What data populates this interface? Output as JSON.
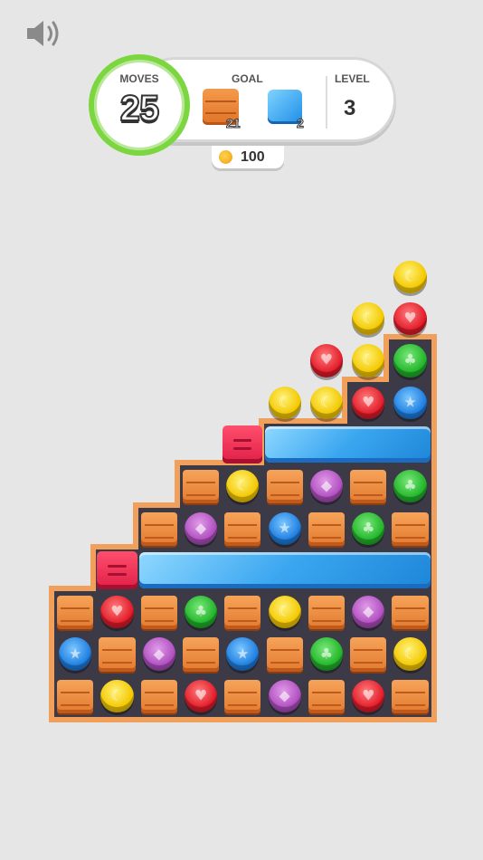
{
  "hud": {
    "moves_label": "MOVES",
    "moves_value": "25",
    "goal_label": "GOAL",
    "goals": [
      {
        "icon": "crate-icon",
        "count": "21"
      },
      {
        "icon": "ice-block-icon",
        "count": "2"
      }
    ],
    "level_label": "LEVEL",
    "level_value": "3",
    "coins": "100"
  },
  "colors": {
    "board_border": "#f0a05a",
    "board_bg": "#3d3a47",
    "moves_ring": "#7bd63f",
    "background": "#e6e6e6"
  },
  "board": {
    "cols": 9,
    "rows": 11,
    "column_heights": [
      3,
      4,
      5,
      6,
      6,
      7,
      7,
      8,
      9
    ],
    "grid": [
      [
        null,
        null,
        null,
        null,
        null,
        null,
        null,
        null,
        "yellow-moon"
      ],
      [
        null,
        null,
        null,
        null,
        null,
        null,
        null,
        "yellow-moon",
        "red-heart"
      ],
      [
        null,
        null,
        null,
        null,
        null,
        null,
        "red-heart",
        "yellow-moon",
        "green-clover"
      ],
      [
        null,
        null,
        null,
        null,
        null,
        "yellow-moon",
        "yellow-moon",
        "red-heart",
        "blue-star"
      ],
      [
        null,
        null,
        null,
        null,
        "pink-block",
        "ice-wide",
        "ice-wide",
        "ice-wide",
        "ice-wide"
      ],
      [
        null,
        null,
        null,
        "crate",
        "yellow-moon",
        "crate",
        "purple-drop",
        "crate",
        "green-clover"
      ],
      [
        null,
        null,
        "crate",
        "purple-drop",
        "crate",
        "blue-star",
        "crate",
        "green-clover",
        "crate"
      ],
      [
        null,
        "pink-block",
        "ice-wide",
        "ice-wide",
        "ice-wide",
        "ice-wide",
        "ice-wide",
        "ice-wide",
        "ice-wide"
      ],
      [
        "crate",
        "red-heart",
        "crate",
        "green-clover",
        "crate",
        "yellow-moon",
        "crate",
        "purple-drop",
        "crate"
      ],
      [
        "blue-star",
        "crate",
        "purple-drop",
        "crate",
        "blue-star",
        "crate",
        "green-clover",
        "crate",
        "yellow-moon"
      ],
      [
        "crate",
        "yellow-moon",
        "crate",
        "red-heart",
        "crate",
        "purple-drop",
        "crate",
        "red-heart",
        "crate"
      ]
    ]
  }
}
